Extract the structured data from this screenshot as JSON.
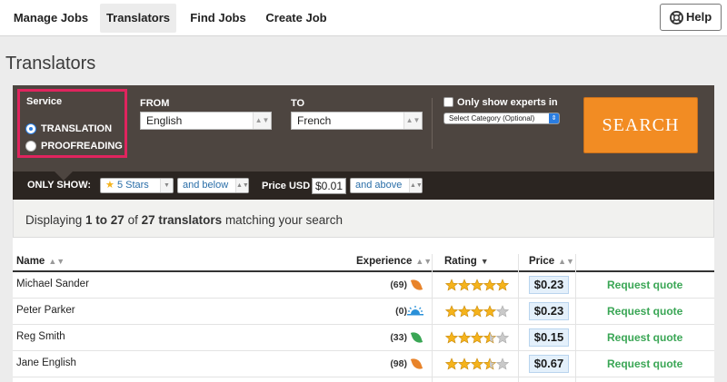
{
  "nav": {
    "tabs": [
      {
        "label": "Manage Jobs"
      },
      {
        "label": "Translators"
      },
      {
        "label": "Find Jobs"
      },
      {
        "label": "Create Job"
      }
    ],
    "help_label": "Help"
  },
  "page": {
    "title": "Translators"
  },
  "search": {
    "service_label": "Service",
    "service_options": [
      "TRANSLATION",
      "PROOFREADING"
    ],
    "service_selected": "TRANSLATION",
    "from_label": "FROM",
    "from_value": "English",
    "to_label": "TO",
    "to_value": "French",
    "experts_label": "Only show experts in",
    "category_value": "Select Category (Optional)",
    "search_label": "SEARCH",
    "only_show_label": "ONLY SHOW:",
    "stars_value": "5 Stars",
    "stars_mod": "and below",
    "price_label": "Price USD",
    "price_value": "$0.01",
    "price_mod": "and above"
  },
  "results": {
    "prefix": "Displaying",
    "range": "1 to 27",
    "of": "of",
    "total": "27 translators",
    "suffix": "matching your search"
  },
  "table": {
    "headers": {
      "name": "Name",
      "experience": "Experience",
      "rating": "Rating",
      "price": "Price"
    },
    "rows": [
      {
        "name": "Michael Sander",
        "experience": "(69)",
        "exp_icon": "orange-leaf-icon",
        "rating": 5,
        "price": "$0.23",
        "action": "Request quote"
      },
      {
        "name": "Peter Parker",
        "experience": "(0)",
        "exp_icon": "sunrise-icon",
        "rating": 4,
        "price": "$0.23",
        "action": "Request quote"
      },
      {
        "name": "Reg Smith",
        "experience": "(33)",
        "exp_icon": "green-leaf-icon",
        "rating": 3.5,
        "price": "$0.15",
        "action": "Request quote"
      },
      {
        "name": "Jane English",
        "experience": "(98)",
        "exp_icon": "orange-leaf-icon",
        "rating": 3.5,
        "price": "$0.67",
        "action": "Request quote"
      }
    ]
  },
  "colors": {
    "accent_orange": "#f28c23",
    "highlight_pink": "#e0245e",
    "panel_brown": "#4d4540",
    "quote_green": "#3aa655",
    "star_gold": "#f5b31b"
  }
}
